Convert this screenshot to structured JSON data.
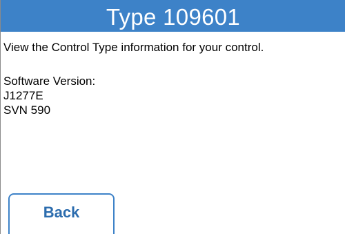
{
  "header": {
    "title": "Type 109601"
  },
  "content": {
    "description": "View the Control Type information for your control.",
    "software_version_label": "Software Version:",
    "software_version": "J1277E",
    "svn": "SVN 590"
  },
  "actions": {
    "back_label": "Back"
  },
  "colors": {
    "header_background": "#3d82c8",
    "header_text": "#ffffff",
    "button_border": "#3d82c8",
    "button_text": "#2b6cae"
  }
}
